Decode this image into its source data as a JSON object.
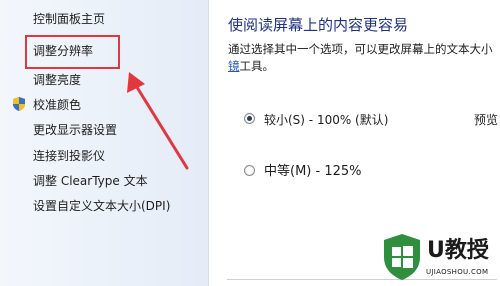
{
  "sidebar": {
    "home_link": "控制面板主页",
    "items": [
      {
        "label": "调整分辨率",
        "icon": null
      },
      {
        "label": "调整亮度",
        "icon": null
      },
      {
        "label": "校准颜色",
        "icon": "shield-icon"
      },
      {
        "label": "更改显示器设置",
        "icon": null
      },
      {
        "label": "连接到投影仪",
        "icon": null
      },
      {
        "label": "调整 ClearType 文本",
        "icon": null
      },
      {
        "label": "设置自定义文本大小(DPI)",
        "icon": null
      }
    ]
  },
  "main": {
    "title": "使阅读屏幕上的内容更容易",
    "description_line1": "通过选择其中一个选项，可以更改屏幕上的文本大小",
    "description_link": "镜",
    "description_line2_rest": "工具。",
    "options": [
      {
        "label": "较小(S) - 100% (默认)",
        "checked": true
      },
      {
        "label": "中等(M) - 125%",
        "checked": false
      }
    ],
    "preview_label": "预览"
  },
  "annotation": {
    "highlight_color": "#e2373f",
    "highlighted_item": "调整分辨率"
  },
  "watermark": {
    "brand": "U教授",
    "domain": "UJIAOSHOU.COM",
    "icon": "windows-logo-icon",
    "icon_color": "#2f8f3e"
  }
}
